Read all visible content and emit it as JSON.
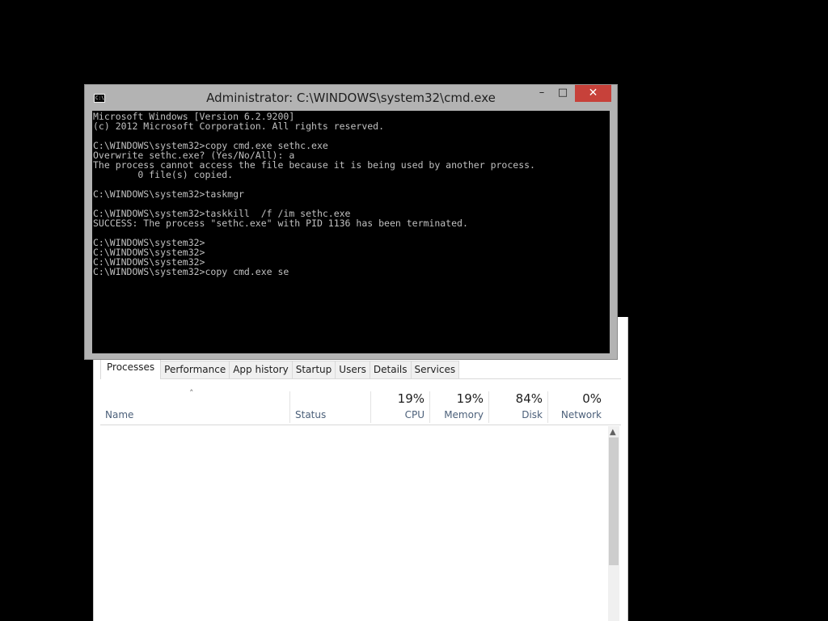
{
  "task_manager": {
    "tabs": [
      {
        "label": "Processes",
        "active": true
      },
      {
        "label": "Performance",
        "active": false
      },
      {
        "label": "App history",
        "active": false
      },
      {
        "label": "Startup",
        "active": false
      },
      {
        "label": "Users",
        "active": false
      },
      {
        "label": "Details",
        "active": false
      },
      {
        "label": "Services",
        "active": false
      }
    ],
    "columns": {
      "name": {
        "label": "Name"
      },
      "status": {
        "label": "Status"
      },
      "cpu": {
        "label": "CPU",
        "percent": "19%"
      },
      "memory": {
        "label": "Memory",
        "percent": "19%"
      },
      "disk": {
        "label": "Disk",
        "percent": "84%"
      },
      "network": {
        "label": "Network",
        "percent": "0%"
      }
    },
    "sort_indicator": "˄"
  },
  "cmd": {
    "title": "Administrator: C:\\WINDOWS\\system32\\cmd.exe",
    "icon_text": "C:\\",
    "buttons": {
      "minimize": "–",
      "maximize": "□",
      "close": "✕"
    },
    "lines": [
      "Microsoft Windows [Version 6.2.9200]",
      "(c) 2012 Microsoft Corporation. All rights reserved.",
      "",
      "C:\\WINDOWS\\system32>copy cmd.exe sethc.exe",
      "Overwrite sethc.exe? (Yes/No/All): a",
      "The process cannot access the file because it is being used by another process.",
      "        0 file(s) copied.",
      "",
      "C:\\WINDOWS\\system32>taskmgr",
      "",
      "C:\\WINDOWS\\system32>taskkill  /f /im sethc.exe",
      "SUCCESS: The process \"sethc.exe\" with PID 1136 has been terminated.",
      "",
      "C:\\WINDOWS\\system32>",
      "C:\\WINDOWS\\system32>",
      "C:\\WINDOWS\\system32>",
      "C:\\WINDOWS\\system32>copy cmd.exe se"
    ]
  },
  "colors": {
    "desktop": "#000000",
    "cmd_frame": "#b3b3b3",
    "cmd_text": "#c0c0c0",
    "close_button": "#c7413a",
    "tm_header_text": "#4c607a"
  }
}
